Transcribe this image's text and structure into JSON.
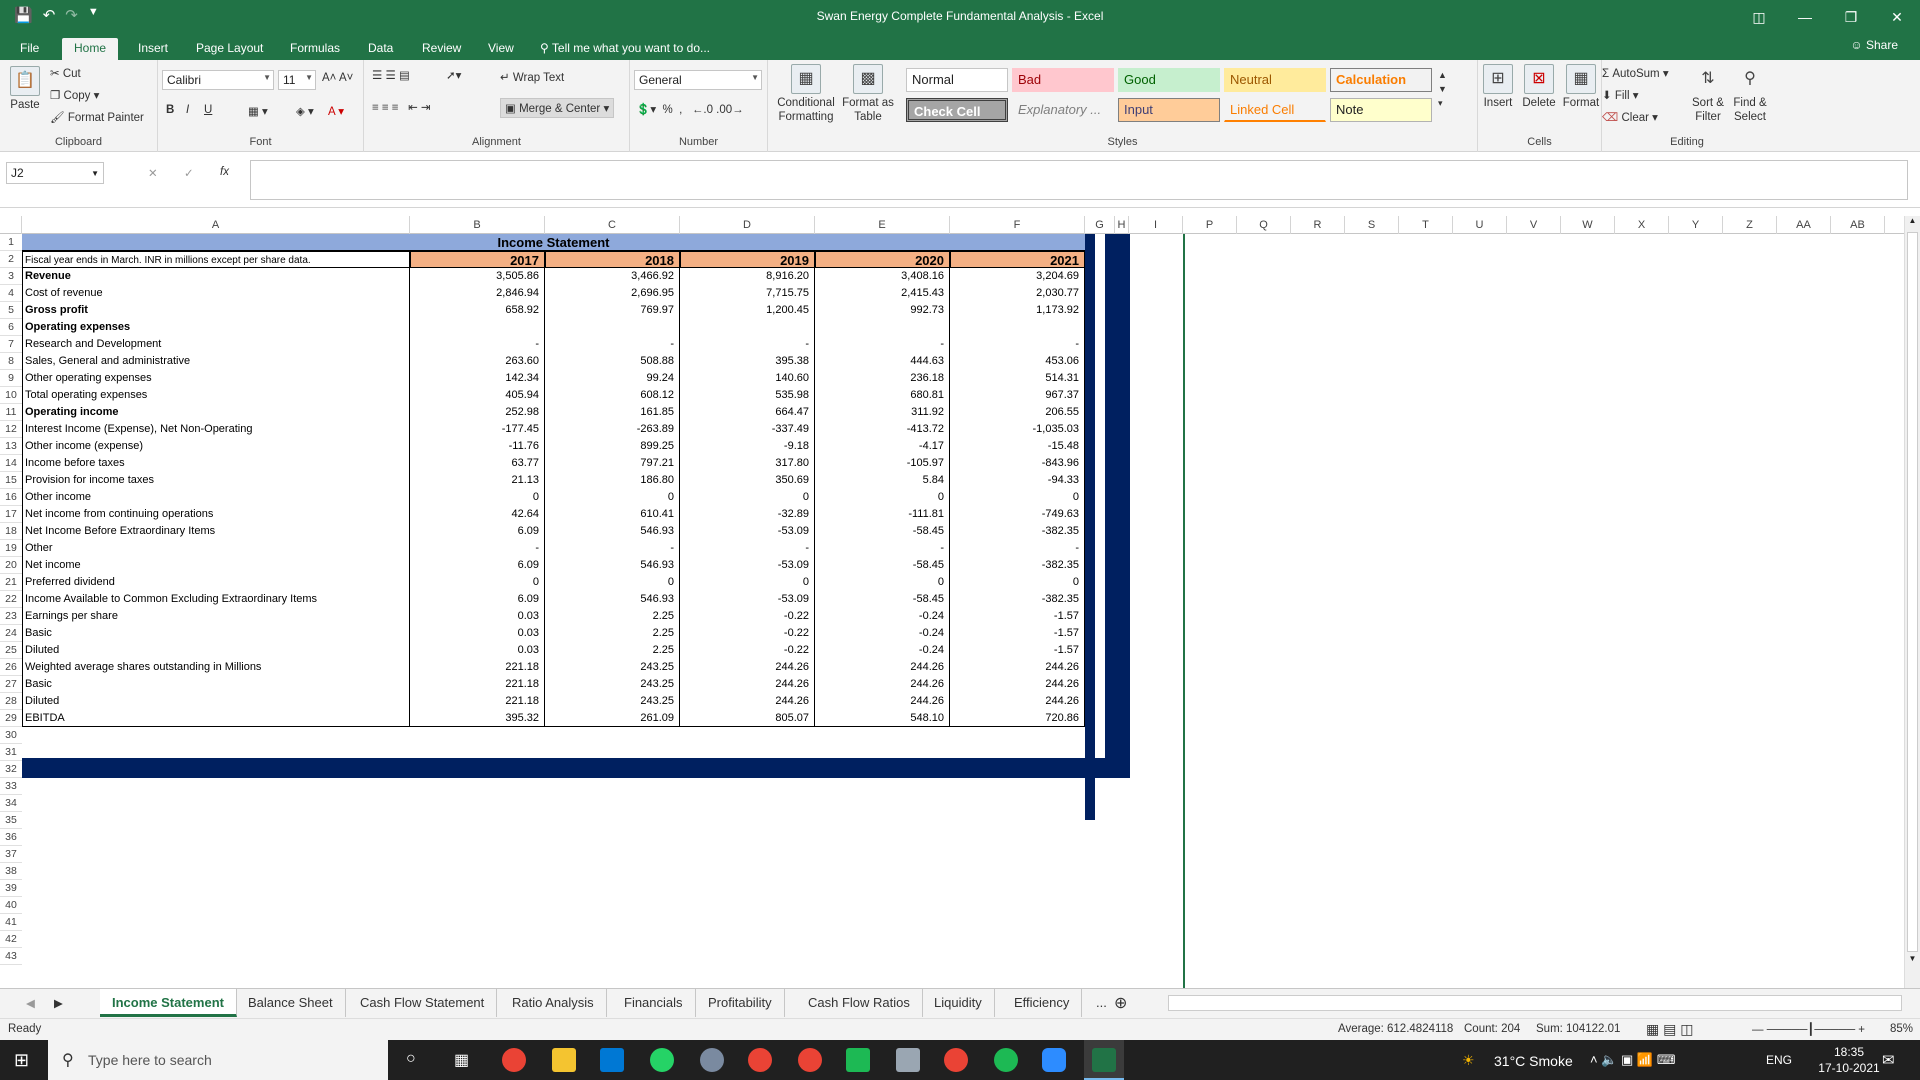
{
  "window": {
    "title": "Swan Energy Complete Fundamental Analysis - Excel"
  },
  "ribbon_tabs": [
    "File",
    "Home",
    "Insert",
    "Page Layout",
    "Formulas",
    "Data",
    "Review",
    "View"
  ],
  "tell_me": "Tell me what you want to do...",
  "share": "Share",
  "clipboard": {
    "paste": "Paste",
    "cut": "Cut",
    "copy": "Copy",
    "format_painter": "Format Painter",
    "label": "Clipboard"
  },
  "font": {
    "name": "Calibri",
    "size": "11",
    "label": "Font"
  },
  "alignment": {
    "wrap": "Wrap Text",
    "merge": "Merge & Center",
    "label": "Alignment"
  },
  "number": {
    "format": "General",
    "label": "Number"
  },
  "styles_group": {
    "cond": "Conditional Formatting",
    "table": "Format as Table",
    "label": "Styles",
    "items": [
      "Normal",
      "Bad",
      "Good",
      "Neutral",
      "Calculation",
      "Check Cell",
      "Explanatory ...",
      "Input",
      "Linked Cell",
      "Note"
    ]
  },
  "cells_group": {
    "insert": "Insert",
    "delete": "Delete",
    "format": "Format",
    "label": "Cells"
  },
  "editing": {
    "autosum": "AutoSum",
    "fill": "Fill",
    "clear": "Clear",
    "sort": "Sort & Filter",
    "find": "Find & Select",
    "label": "Editing"
  },
  "formula_bar": {
    "name_box": "J2",
    "fx": "fx",
    "value": ""
  },
  "columns": [
    "A",
    "B",
    "C",
    "D",
    "E",
    "F",
    "G",
    "H",
    "I",
    "P",
    "Q",
    "R",
    "S",
    "T",
    "U",
    "V",
    "W",
    "X",
    "Y",
    "Z",
    "AA",
    "AB"
  ],
  "row_numbers": [
    "1",
    "2",
    "3",
    "4",
    "5",
    "6",
    "7",
    "8",
    "9",
    "10",
    "11",
    "12",
    "13",
    "14",
    "15",
    "16",
    "17",
    "18",
    "19",
    "20",
    "21",
    "22",
    "23",
    "24",
    "25",
    "26",
    "27",
    "28",
    "29",
    "30",
    "31",
    "32",
    "33",
    "34",
    "35",
    "36",
    "37",
    "38",
    "39",
    "40",
    "41",
    "42",
    "43"
  ],
  "statement": {
    "title": "Income Statement",
    "subtitle": "Fiscal year ends in March. INR in millions except per share data.",
    "years": [
      "2017",
      "2018",
      "2019",
      "2020",
      "2021"
    ],
    "rows": [
      {
        "label": "Revenue",
        "bold": true,
        "v": [
          "3,505.86",
          "3,466.92",
          "8,916.20",
          "3,408.16",
          "3,204.69"
        ]
      },
      {
        "label": "Cost of revenue",
        "v": [
          "2,846.94",
          "2,696.95",
          "7,715.75",
          "2,415.43",
          "2,030.77"
        ]
      },
      {
        "label": "Gross profit",
        "bold": true,
        "v": [
          "658.92",
          "769.97",
          "1,200.45",
          "992.73",
          "1,173.92"
        ]
      },
      {
        "label": "Operating expenses",
        "bold": true,
        "v": [
          "",
          "",
          "",
          "",
          ""
        ]
      },
      {
        "label": "Research and Development",
        "v": [
          "-",
          "-",
          "-",
          "-",
          "-"
        ]
      },
      {
        "label": "Sales, General and administrative",
        "v": [
          "263.60",
          "508.88",
          "395.38",
          "444.63",
          "453.06"
        ]
      },
      {
        "label": "Other operating expenses",
        "v": [
          "142.34",
          "99.24",
          "140.60",
          "236.18",
          "514.31"
        ]
      },
      {
        "label": "Total operating expenses",
        "v": [
          "405.94",
          "608.12",
          "535.98",
          "680.81",
          "967.37"
        ]
      },
      {
        "label": "Operating income",
        "bold": true,
        "v": [
          "252.98",
          "161.85",
          "664.47",
          "311.92",
          "206.55"
        ]
      },
      {
        "label": " Interest Income (Expense), Net Non-Operating",
        "v": [
          "-177.45",
          "-263.89",
          "-337.49",
          "-413.72",
          "-1,035.03"
        ]
      },
      {
        "label": "Other income (expense)",
        "v": [
          "-11.76",
          "899.25",
          "-9.18",
          "-4.17",
          "-15.48"
        ]
      },
      {
        "label": "Income before taxes",
        "v": [
          "63.77",
          "797.21",
          "317.80",
          "-105.97",
          "-843.96"
        ]
      },
      {
        "label": "Provision for income taxes",
        "v": [
          "21.13",
          "186.80",
          "350.69",
          "5.84",
          "-94.33"
        ]
      },
      {
        "label": "Other income",
        "v": [
          "0",
          "0",
          "0",
          "0",
          "0"
        ]
      },
      {
        "label": "Net income from continuing operations",
        "v": [
          "42.64",
          "610.41",
          "-32.89",
          "-111.81",
          "-749.63"
        ]
      },
      {
        "label": " Net Income Before Extraordinary Items",
        "v": [
          "6.09",
          "546.93",
          "-53.09",
          "-58.45",
          "-382.35"
        ]
      },
      {
        "label": "Other",
        "v": [
          "-",
          "-",
          "-",
          "-",
          "-"
        ]
      },
      {
        "label": "Net income",
        "v": [
          "6.09",
          "546.93",
          "-53.09",
          "-58.45",
          "-382.35"
        ]
      },
      {
        "label": "Preferred dividend",
        "v": [
          "0",
          "0",
          "0",
          "0",
          "0"
        ]
      },
      {
        "label": " Income Available to Common Excluding Extraordinary Items",
        "v": [
          "6.09",
          "546.93",
          "-53.09",
          "-58.45",
          "-382.35"
        ]
      },
      {
        "label": "Earnings per share",
        "v": [
          "0.03",
          "2.25",
          "-0.22",
          "-0.24",
          "-1.57"
        ]
      },
      {
        "label": "Basic",
        "v": [
          "0.03",
          "2.25",
          "-0.22",
          "-0.24",
          "-1.57"
        ]
      },
      {
        "label": "Diluted",
        "v": [
          "0.03",
          "2.25",
          "-0.22",
          "-0.24",
          "-1.57"
        ]
      },
      {
        "label": "Weighted average shares outstanding in Millions",
        "v": [
          "221.18",
          "243.25",
          "244.26",
          "244.26",
          "244.26"
        ]
      },
      {
        "label": "Basic",
        "v": [
          "221.18",
          "243.25",
          "244.26",
          "244.26",
          "244.26"
        ]
      },
      {
        "label": "Diluted",
        "v": [
          "221.18",
          "243.25",
          "244.26",
          "244.26",
          "244.26"
        ]
      },
      {
        "label": "EBITDA",
        "v": [
          "395.32",
          "261.09",
          "805.07",
          "548.10",
          "720.86"
        ]
      }
    ]
  },
  "sheet_tabs": [
    "Income Statement",
    "Balance Sheet",
    "Cash Flow Statement",
    "Ratio Analysis",
    "Financials",
    "Profitability",
    "Cash Flow Ratios",
    "Liquidity",
    "Efficiency",
    "..."
  ],
  "status": {
    "ready": "Ready",
    "average": "Average: 612.4824118",
    "count": "Count: 204",
    "sum": "Sum: 104122.01",
    "zoom": "85%"
  },
  "taskbar": {
    "search": "Type here to search",
    "weather": "31°C  Smoke",
    "lang": "ENG",
    "time": "18:35",
    "date": "17-10-2021"
  },
  "colors": {
    "excel_green": "#217346",
    "header_blue": "#8EA9DB",
    "year_orange": "#F4B084",
    "navy": "#002060"
  }
}
